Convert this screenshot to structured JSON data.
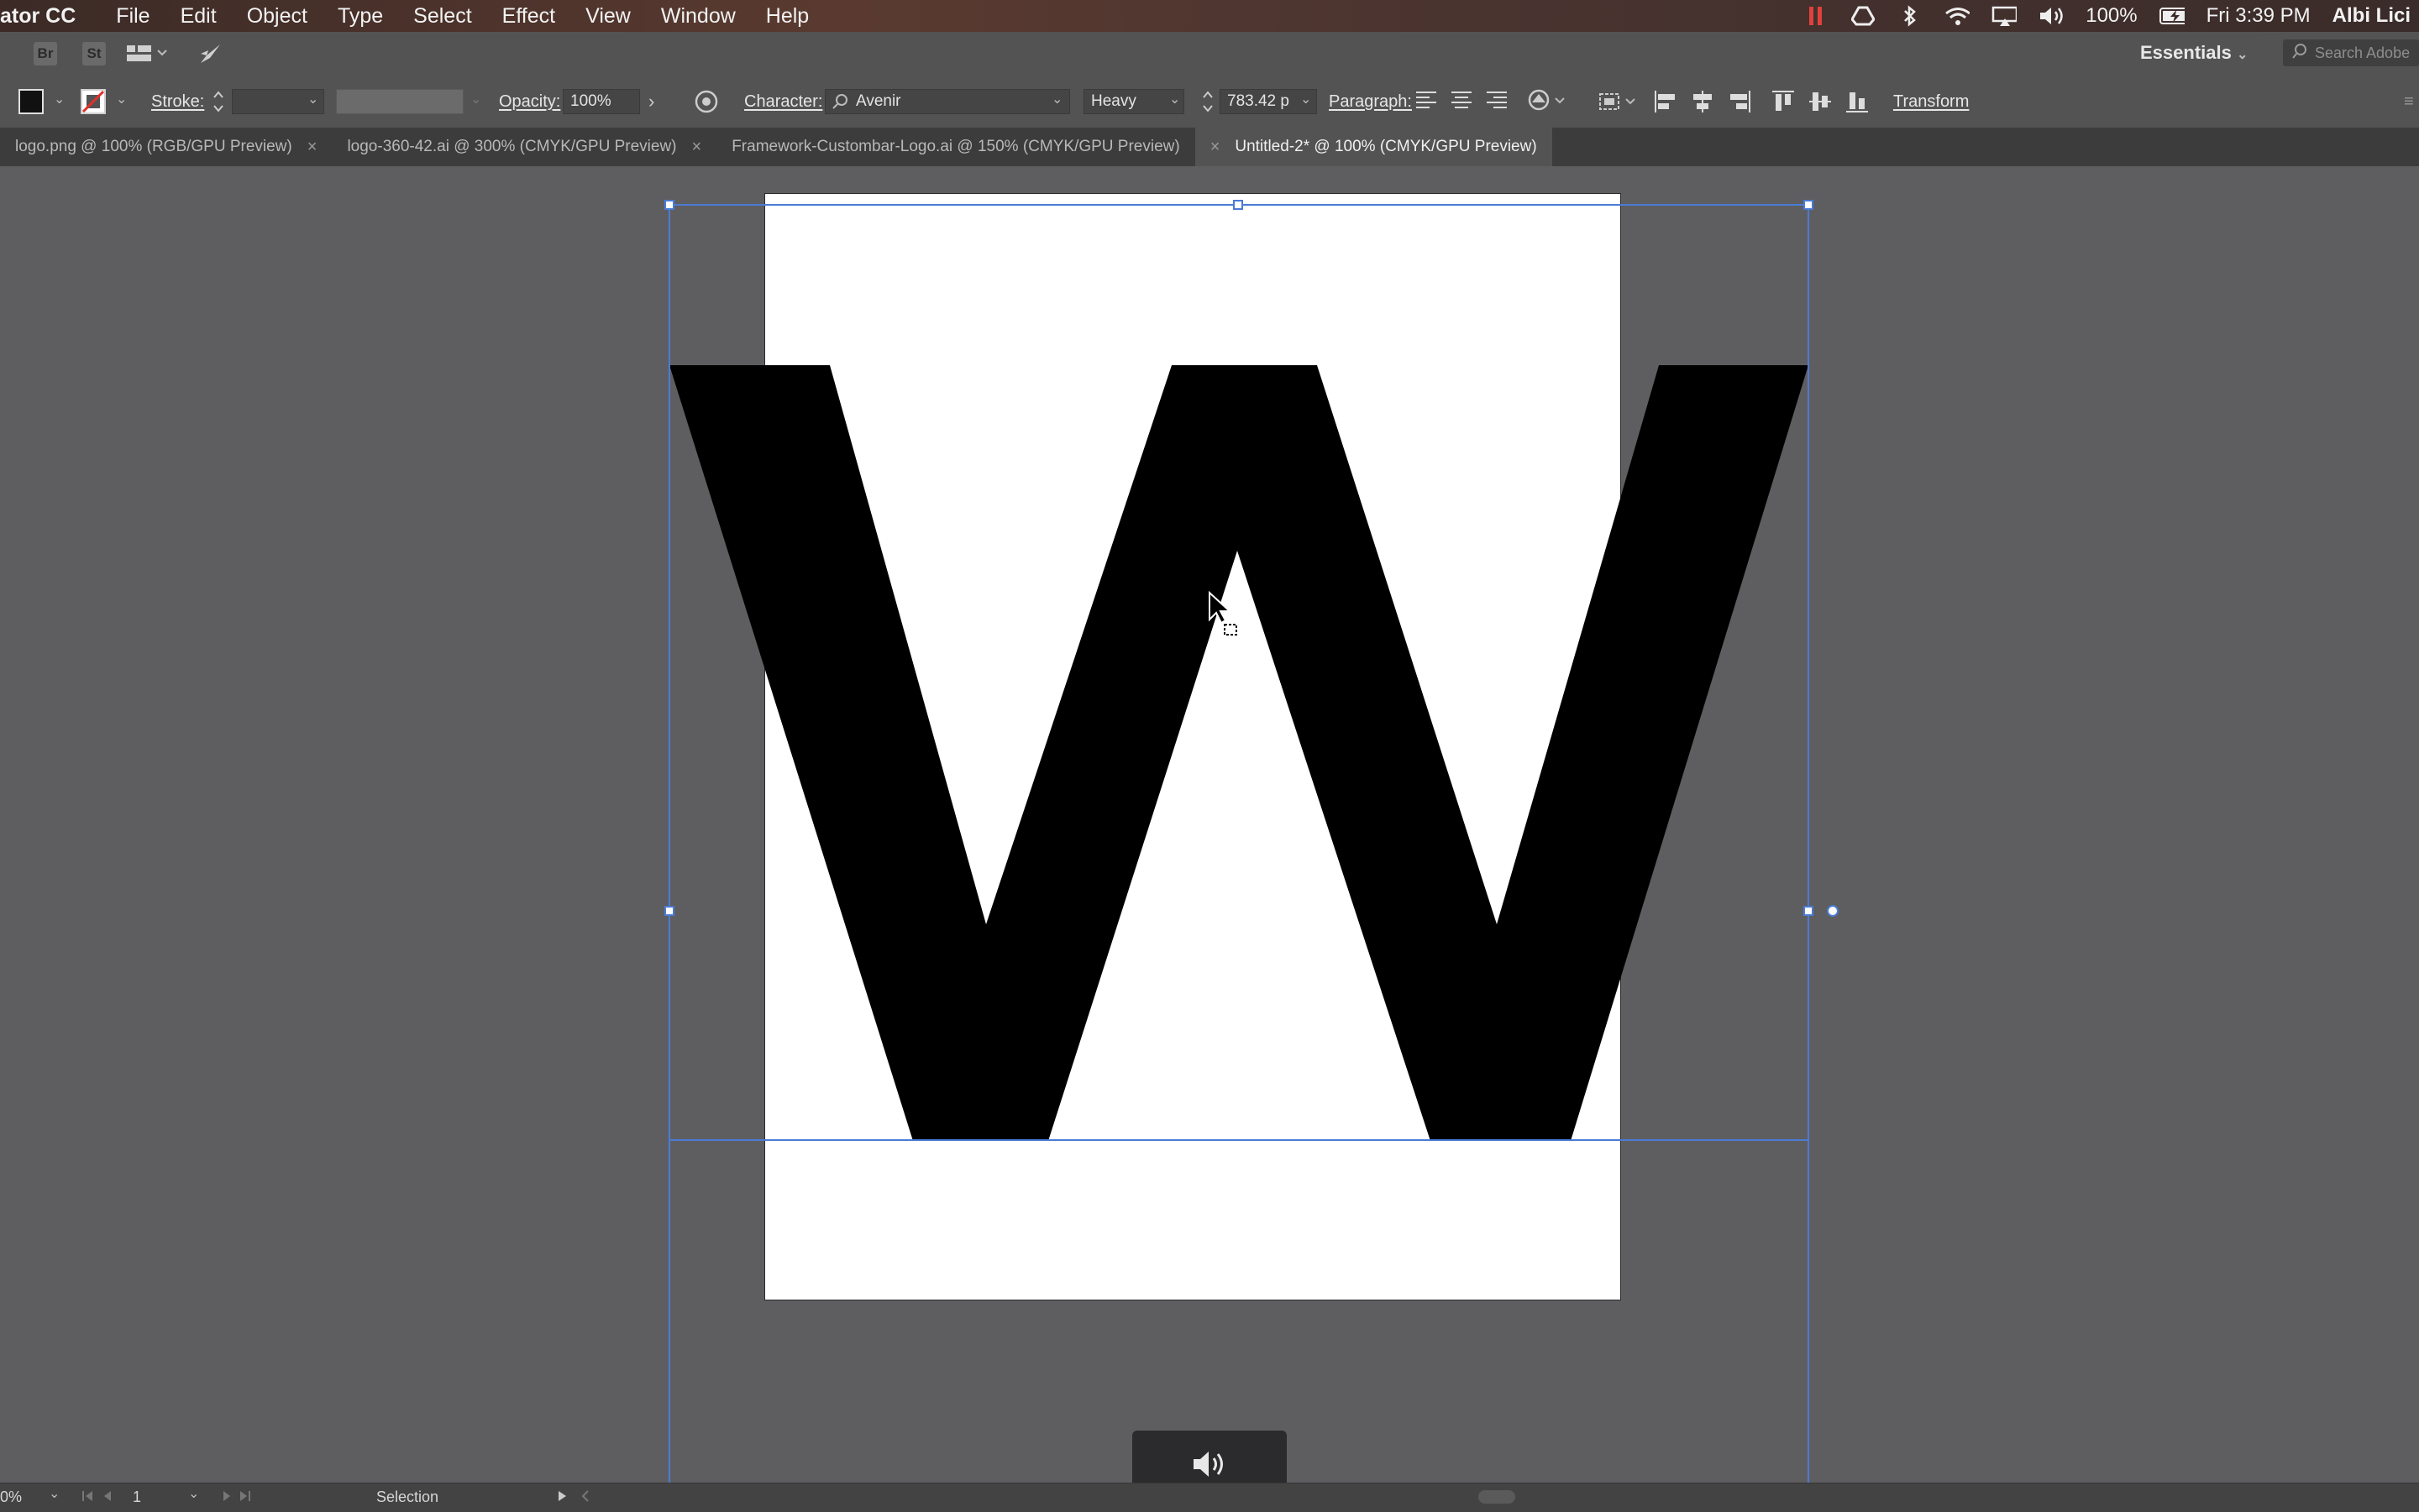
{
  "menubar": {
    "app_name": "ator CC",
    "menus": [
      "File",
      "Edit",
      "Object",
      "Type",
      "Select",
      "Effect",
      "View",
      "Window",
      "Help"
    ],
    "battery": "100%",
    "clock": "Fri 3:39 PM",
    "user": "Albi Lici"
  },
  "appbar": {
    "bridge_label": "Br",
    "stock_label": "St",
    "workspace": "Essentials",
    "search_placeholder": "Search Adobe"
  },
  "controlbar": {
    "stroke_label": "Stroke:",
    "opacity_label": "Opacity:",
    "opacity_value": "100%",
    "character_label": "Character:",
    "font_family": "Avenir",
    "font_style": "Heavy",
    "font_size": "783.42 p",
    "paragraph_label": "Paragraph:",
    "transform_label": "Transform"
  },
  "tabs": [
    {
      "label": "logo.png @ 100% (RGB/GPU Preview)",
      "active": false
    },
    {
      "label": "logo-360-42.ai @ 300% (CMYK/GPU Preview)",
      "active": false
    },
    {
      "label": "Framework-Custombar-Logo.ai @ 150% (CMYK/GPU Preview)",
      "active": false
    },
    {
      "label": "Untitled-2* @ 100% (CMYK/GPU Preview)",
      "active": true
    }
  ],
  "canvas": {
    "glyph_text": "W"
  },
  "statusbar": {
    "zoom": "0%",
    "artboard_number": "1",
    "tool": "Selection"
  },
  "colors": {
    "selection": "#4a7bd6",
    "canvas_bg": "#5e5e60",
    "panel_bg": "#535353"
  }
}
